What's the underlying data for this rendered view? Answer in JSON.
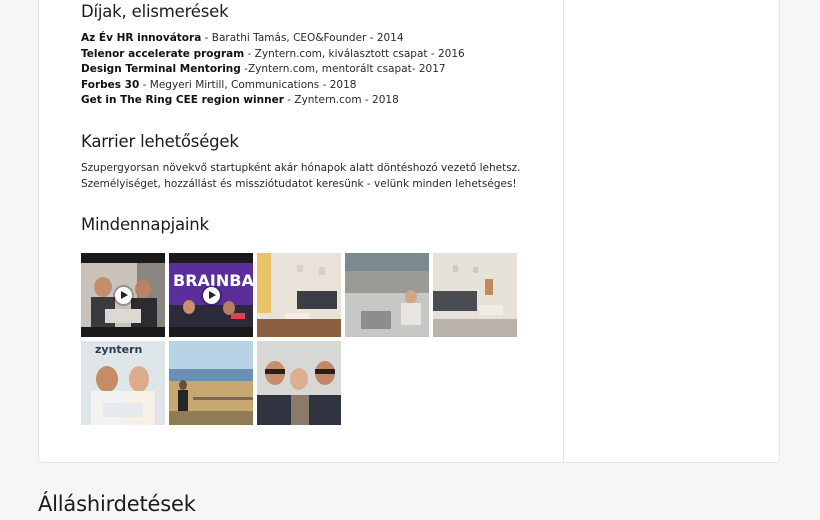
{
  "awards_section": {
    "title": "Díjak, elismerések",
    "items": [
      {
        "bold": "Az Év HR innovátora",
        "rest": " - Barathi Tamás, CEO&Founder - 2014"
      },
      {
        "bold": "Telenor accelerate program",
        "rest": " - Zyntern.com, kiválasztott csapat - 2016"
      },
      {
        "bold": "Design Terminal Mentoring",
        "rest": " -Zyntern.com, mentorált csapat- 2017"
      },
      {
        "bold": "Forbes 30",
        "rest": " - Megyeri Mirtill, Communications - 2018"
      },
      {
        "bold": "Get in The Ring CEE region winner",
        "rest": " - Zyntern.com - 2018"
      }
    ]
  },
  "career_section": {
    "title": "Karrier lehetőségek",
    "line1": "Szupergyorsan növekvő startupként akár hónapok alatt döntéshozó vezető lehetsz.",
    "line2": "Személyiséget, hozzállást és missziótudatot keresünk - velünk minden lehetséges!"
  },
  "everyday_section": {
    "title": "Mindennapjaink",
    "thumb_texts": {
      "brainbar": "BRAINBA",
      "zyntern": "zyntern"
    }
  },
  "jobs_section": {
    "title": "Álláshirdetések"
  }
}
